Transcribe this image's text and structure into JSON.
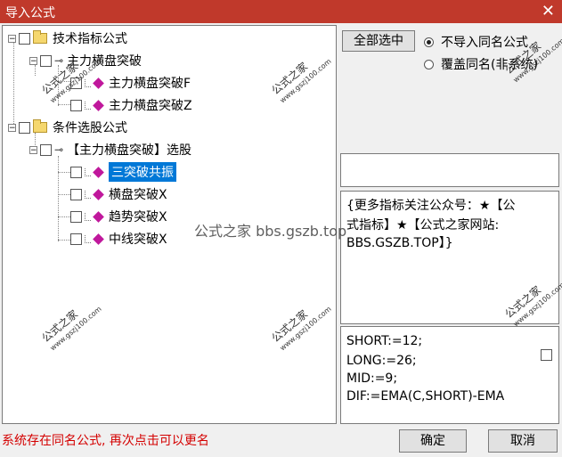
{
  "window": {
    "title": "导入公式",
    "close_glyph": "✕"
  },
  "tree": {
    "n1": "技术指标公式",
    "n2": "主力横盘突破",
    "n3": "主力横盘突破F",
    "n4": "主力横盘突破Z",
    "n5": "条件选股公式",
    "n6": "【主力横盘突破】选股",
    "n7": "三突破共振",
    "n8": "横盘突破X",
    "n9": "趋势突破X",
    "n10": "中线突破X"
  },
  "watermark": {
    "brand": "公式之家",
    "site": "www.gszj100.com",
    "overlay": "公式之家 bbs.gszb.top"
  },
  "controls": {
    "select_all": "全部选中",
    "radio1": "不导入同名公式",
    "radio2": "覆盖同名(非系统)",
    "ok": "确定",
    "cancel": "取消"
  },
  "info_text": [
    "{更多指标关注公众号：★【公",
    "式指标】★【公式之家网站:",
    "BBS.GSZB.TOP】}"
  ],
  "code_text": [
    "SHORT:=12;",
    "LONG:=26;",
    "MID:=9;",
    "DIF:=EMA(C,SHORT)-EMA"
  ],
  "status": "系统存在同名公式, 再次点击可以更名",
  "colors": {
    "title_bar": "#c0392b",
    "selection": "#0078d7",
    "status_text": "#d40000"
  }
}
